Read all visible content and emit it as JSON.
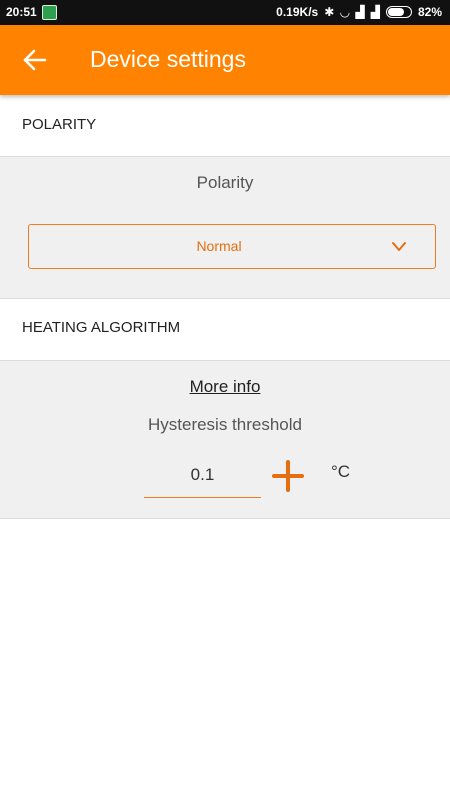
{
  "status_bar": {
    "time": "20:51",
    "net_speed": "0.19K/s",
    "battery": "82%",
    "battery_level": 0.82
  },
  "app_bar": {
    "title": "Device settings",
    "color": "#ff8200"
  },
  "polarity_section": {
    "header": "POLARITY",
    "label": "Polarity",
    "selected_value": "Normal"
  },
  "heating_section": {
    "header": "HEATING ALGORITHM",
    "more_info": "More info",
    "hysteresis_label": "Hysteresis threshold",
    "hysteresis_value": "0.1",
    "unit": "°C"
  },
  "colors": {
    "accent": "#ff8200",
    "accent_text": "#e56e10",
    "panel_bg": "#f0f0f0"
  }
}
